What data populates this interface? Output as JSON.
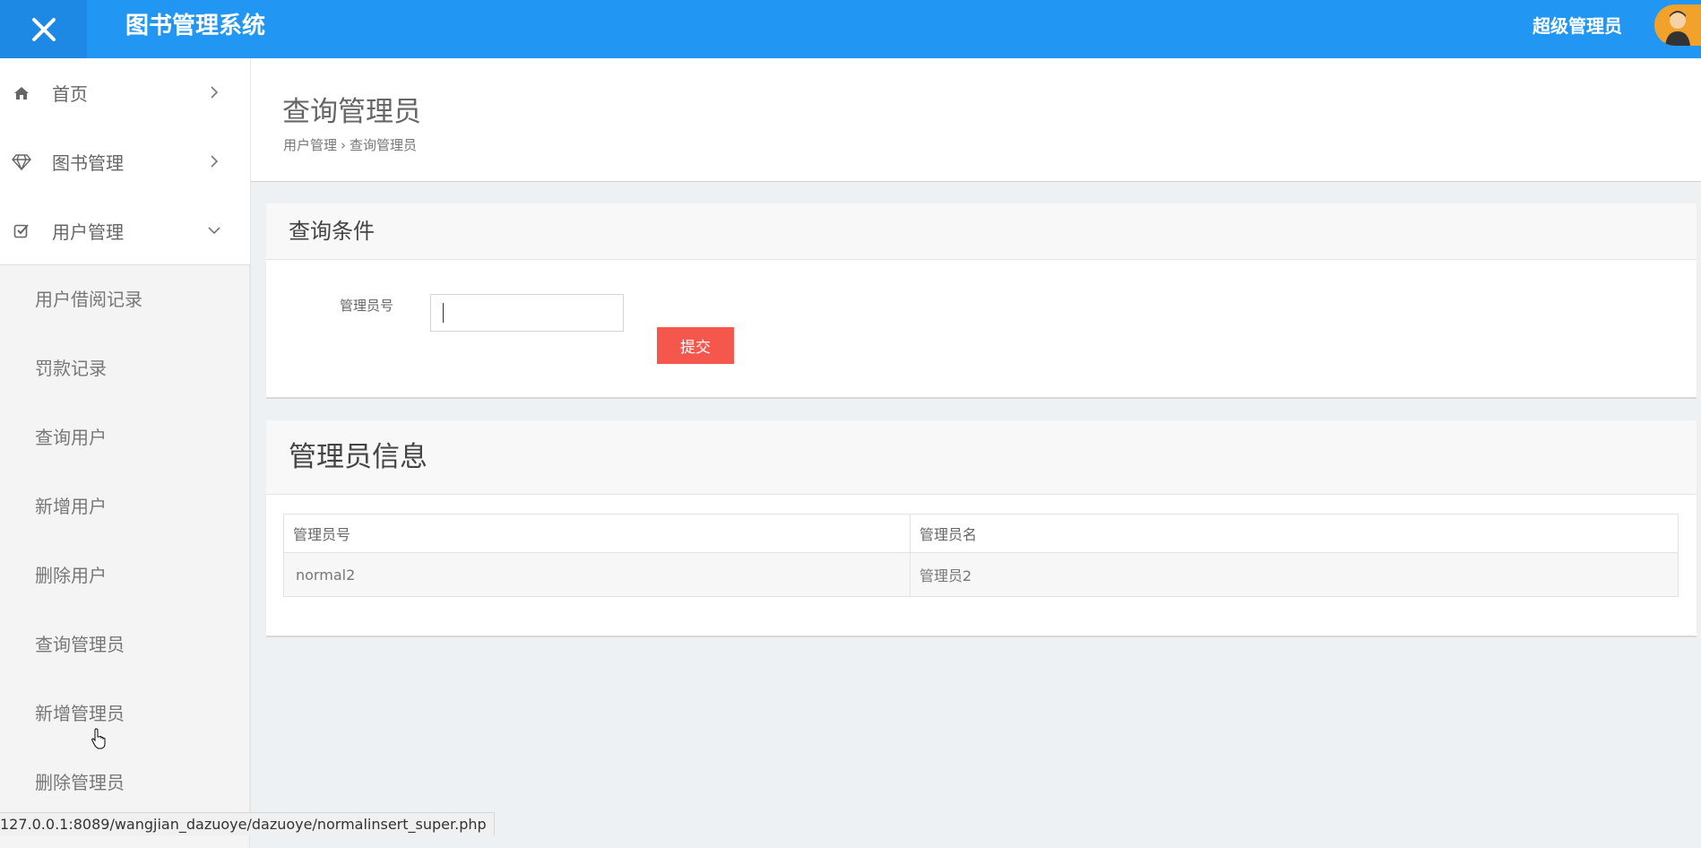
{
  "header": {
    "brand": "图书管理系统",
    "user": "超级管理员"
  },
  "sidebar": {
    "items": [
      {
        "label": "首页",
        "icon": "home-icon"
      },
      {
        "label": "图书管理",
        "icon": "diamond-icon"
      },
      {
        "label": "用户管理",
        "icon": "checkbox-icon"
      }
    ],
    "sub_items": [
      "用户借阅记录",
      "罚款记录",
      "查询用户",
      "新增用户",
      "删除用户",
      "查询管理员",
      "新增管理员",
      "删除管理员"
    ]
  },
  "page": {
    "title": "查询管理员",
    "breadcrumb": [
      "用户管理",
      "查询管理员"
    ],
    "breadcrumb_sep": "›"
  },
  "query_panel": {
    "title": "查询条件",
    "field_label": "管理员号",
    "field_value": "",
    "submit_label": "提交"
  },
  "info_panel": {
    "title": "管理员信息",
    "columns": [
      "管理员号",
      "管理员名"
    ],
    "rows": [
      [
        "normal2",
        "管理员2"
      ]
    ]
  },
  "status_bar": {
    "url": "127.0.0.1:8089/wangjian_dazuoye/dazuoye/normalinsert_super.php"
  },
  "colors": {
    "header": "#2196f3",
    "submit": "#f6574d"
  }
}
